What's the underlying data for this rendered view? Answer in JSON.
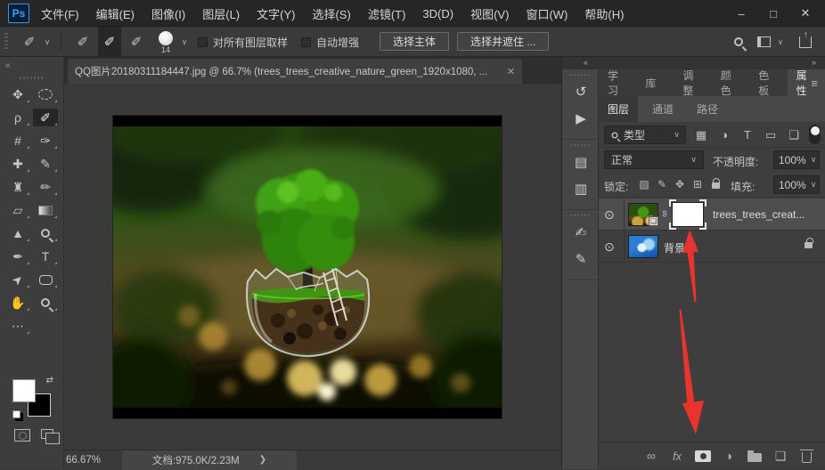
{
  "window": {
    "app_badge": "Ps",
    "controls": {
      "minimize": "–",
      "maximize": "□",
      "close": "✕"
    }
  },
  "menu": {
    "items": [
      "文件(F)",
      "编辑(E)",
      "图像(I)",
      "图层(L)",
      "文字(Y)",
      "选择(S)",
      "滤镜(T)",
      "3D(D)",
      "视图(V)",
      "窗口(W)",
      "帮助(H)"
    ]
  },
  "options_bar": {
    "brush_size": "14",
    "sample_all_layers_label": "对所有图层取样",
    "auto_enhance_label": "自动增强",
    "select_subject_button": "选择主体",
    "select_and_mask_button": "选择并遮住 ..."
  },
  "document_tab": {
    "title": "QQ图片20180311184447.jpg @ 66.7% (trees_trees_creative_nature_green_1920x1080, ...",
    "close": "✕"
  },
  "panels": {
    "group1_tabs": [
      "学习",
      "库",
      "调整",
      "颜色",
      "色板",
      "属性"
    ],
    "group1_active": "属性",
    "group2_tabs": [
      "图层",
      "通道",
      "路径"
    ],
    "group2_active": "图层"
  },
  "layers_panel": {
    "filter_label": "类型",
    "blend_mode": "正常",
    "opacity_label": "不透明度:",
    "opacity_value": "100%",
    "lock_label": "锁定:",
    "fill_label": "填充:",
    "fill_value": "100%",
    "layers": [
      {
        "name": "trees_trees_creat...",
        "selected": true,
        "has_mask": true
      },
      {
        "name": "背景",
        "locked": true
      }
    ]
  },
  "status_bar": {
    "zoom_level": "66.67%",
    "document_info": "文档:975.0K/2.23M",
    "chevron": "❯"
  },
  "icons": {
    "collapse": "«",
    "expand": "»",
    "panel_menu": "≡",
    "chevron_down": "∨",
    "move": "✥",
    "lasso": "ρ",
    "quick_select": "✐",
    "crop": "#",
    "eyedropper": "✑",
    "healing": "✚",
    "brush": "✎",
    "stamp": "♜",
    "history_brush": "✏",
    "eraser": "▱",
    "sharpen": "▲",
    "pen": "✒",
    "type": "T",
    "path_select": "➤",
    "hand": "✋",
    "more": "⋯",
    "swap": "⇄",
    "mode_new": "✐",
    "mode_add": "✐",
    "mode_subtract": "✐",
    "share_arrow": "↑",
    "history": "↺",
    "actions_play": "▶",
    "character": "▤",
    "paragraph": "▥",
    "brush_settings": "✍",
    "brushes": "✎",
    "eye": "⊙",
    "mask_link": "∞",
    "smart_badge": "❏",
    "filter_pixel": "▦",
    "filter_adjust": "◑",
    "filter_type": "T",
    "filter_shape": "▭",
    "filter_smart": "❏",
    "lock_transparent": "▨",
    "lock_paint": "✎",
    "lock_position": "✥",
    "lock_artboard": "⊞",
    "bb_link": "∞",
    "bb_fx": "fx",
    "bb_adjust": "◑",
    "bb_new_layer": "❏"
  },
  "colors": {
    "arrow_red": "#e8342c",
    "ps_logo_blue": "#31a8ff",
    "canopy_green": "#3c9712",
    "bokeh_gold": "#e7c765",
    "mask_white": "#ffffff",
    "selected_row_gray": "#4e4e4e"
  }
}
